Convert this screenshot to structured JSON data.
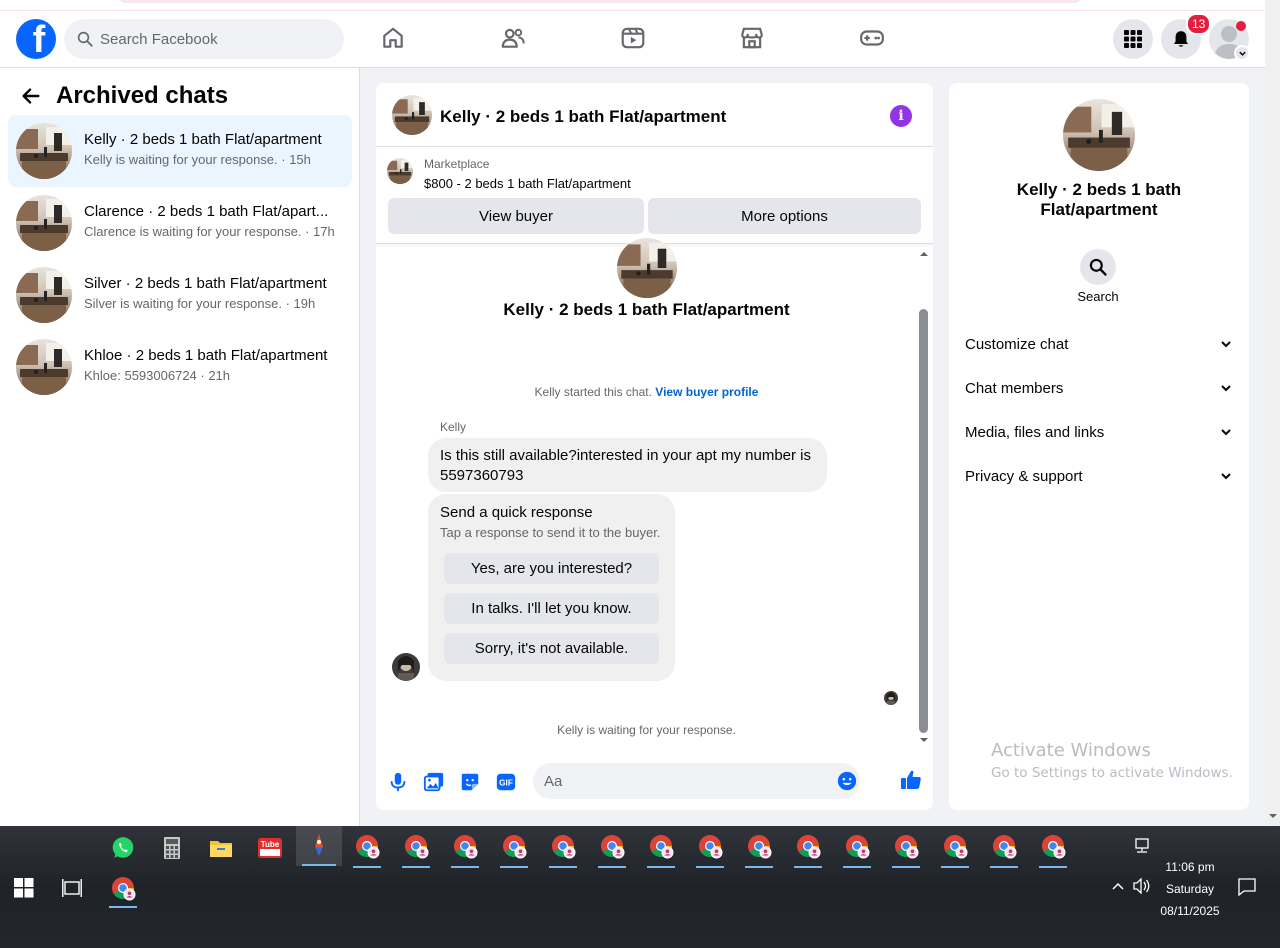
{
  "header": {
    "search_placeholder": "Search Facebook",
    "notification_count": "13",
    "nav": [
      "home-icon",
      "friends-icon",
      "watch-icon",
      "marketplace-icon",
      "gaming-icon"
    ]
  },
  "sidebar": {
    "title": "Archived chats",
    "chats": [
      {
        "name": "Kelly · 2 beds 1 bath Flat/apartment",
        "subtitle": "Kelly is waiting for your response. · 15h"
      },
      {
        "name": "Clarence · 2 beds 1 bath Flat/apart...",
        "subtitle": "Clarence is waiting for your response. · 17h"
      },
      {
        "name": "Silver · 2 beds 1 bath Flat/apartment",
        "subtitle": "Silver is waiting for your response. · 19h"
      },
      {
        "name": "Khloe · 2 beds 1 bath Flat/apartment",
        "subtitle": "Khloe: 5593006724 · 21h"
      }
    ]
  },
  "conversation": {
    "title": "Kelly · 2 beds 1 bath Flat/apartment",
    "marketplace_label": "Marketplace",
    "listing": "$800 - 2 beds 1 bath Flat/apartment",
    "view_buyer": "View buyer",
    "more_options": "More options",
    "profile_name": "Kelly · 2 beds 1 bath Flat/apartment",
    "started_text": "Kelly started this chat.",
    "view_buyer_profile": "View buyer profile",
    "sender": "Kelly",
    "message": "Is this still available?interested in your apt my number is 5597360793",
    "quick_title": "Send a quick response",
    "quick_sub": "Tap a response to send it to the buyer.",
    "quick_responses": [
      "Yes, are you interested?",
      "In talks. I'll let you know.",
      "Sorry, it's not available."
    ],
    "waiting": "Kelly is waiting for your response.",
    "compose_placeholder": "Aa"
  },
  "details": {
    "name": "Kelly · 2 beds 1 bath Flat/apartment",
    "search_label": "Search",
    "sections": [
      "Customize chat",
      "Chat members",
      "Media, files and links",
      "Privacy & support"
    ]
  },
  "watermark": {
    "line1": "Activate Windows",
    "line2": "Go to Settings to activate Windows."
  },
  "taskbar": {
    "time": "11:06 pm",
    "day": "Saturday",
    "date": "08/11/2025"
  },
  "colors": {
    "brand": "#0866ff",
    "accent_purple": "#9334e6",
    "link": "#0064d1",
    "badge": "#e41e3f"
  }
}
